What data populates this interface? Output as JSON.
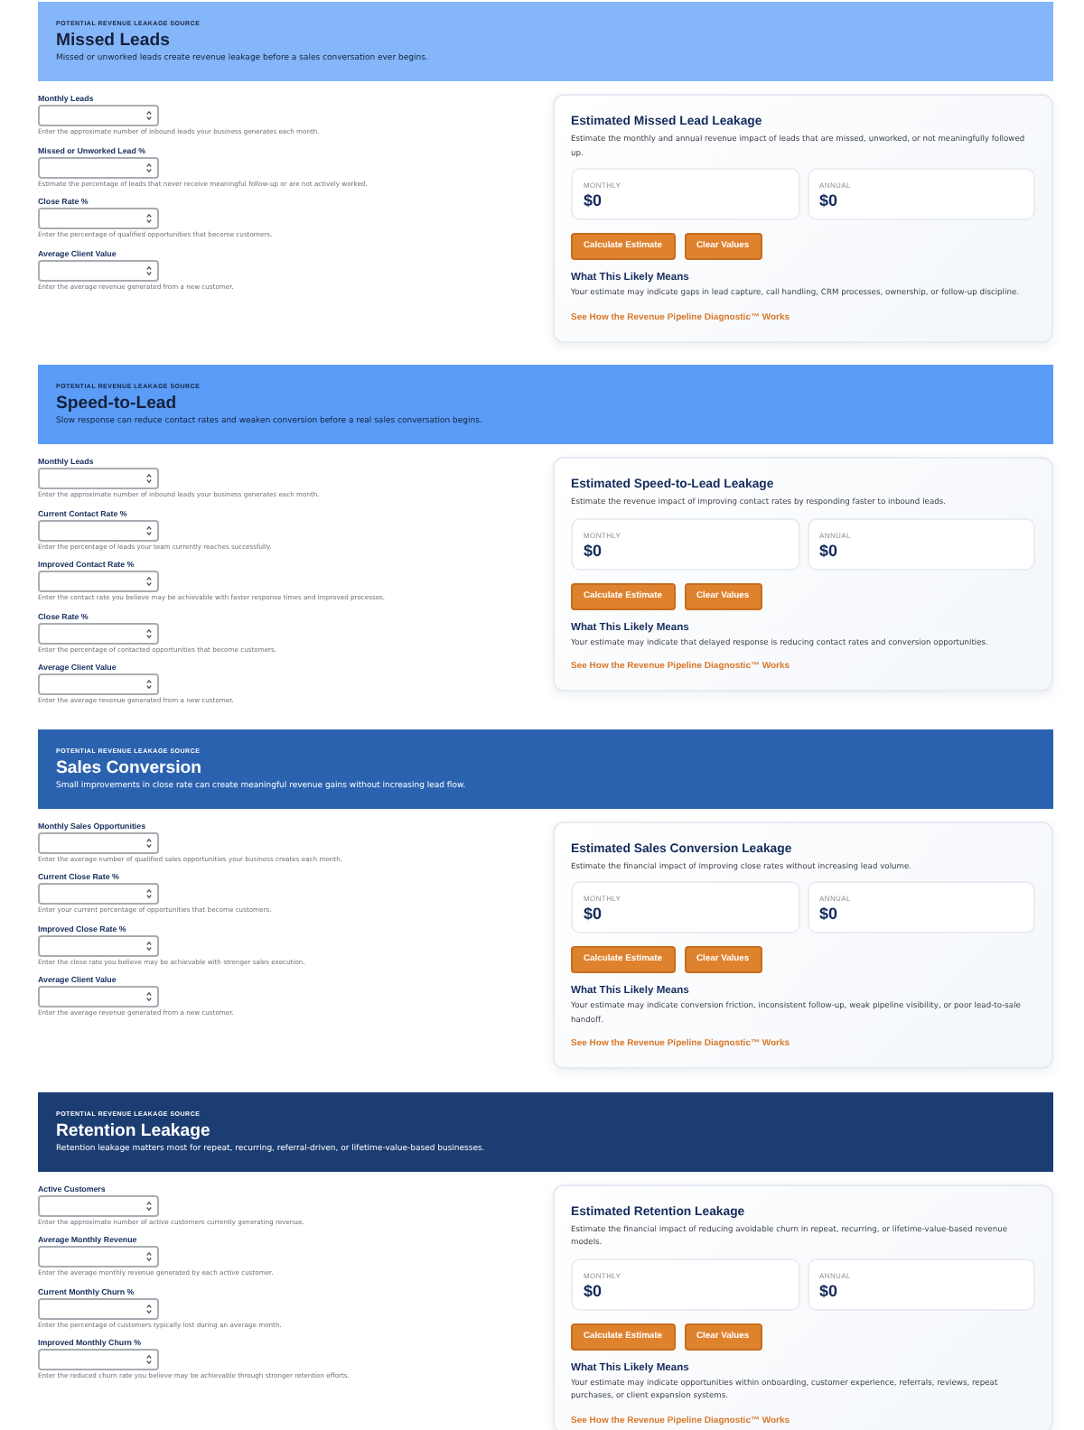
{
  "sections": [
    {
      "eyebrow": "POTENTIAL REVENUE LEAKAGE SOURCE",
      "title": "Missed Leads",
      "subtitle": "Missed or unworked leads create revenue leakage before a sales conversation ever begins.",
      "color": "#85b6f9",
      "fields": [
        {
          "label": "Monthly Leads",
          "help": "Enter the approximate number of inbound leads your business generates each month."
        },
        {
          "label": "Missed or Unworked Lead %",
          "help": "Estimate the percentage of leads that never receive meaningful follow-up or are not actively worked."
        },
        {
          "label": "Close Rate %",
          "help": "Enter the percentage of qualified opportunities that become customers."
        },
        {
          "label": "Average Client Value",
          "help": "Enter the average revenue generated from a new customer."
        }
      ],
      "card": {
        "title": "Estimated Missed Lead Leakage",
        "description": "Estimate the monthly and annual revenue impact of leads that are missed, unworked, or not meaningfully followed up.",
        "results": [
          {
            "label": "MONTHLY",
            "value": "$0"
          },
          {
            "label": "ANNUAL",
            "value": "$0"
          }
        ],
        "buttons": [
          "Calculate Estimate",
          "Clear Values"
        ],
        "means_title": "What This Likely Means",
        "means_text": "Your estimate may indicate gaps in lead capture, call handling, CRM processes, ownership, or follow-up discipline.",
        "link": "See How the Revenue Pipeline Diagnostic™ Works"
      }
    },
    {
      "eyebrow": "POTENTIAL REVENUE LEAKAGE SOURCE",
      "title": "Speed-to-Lead",
      "subtitle": "Slow response can reduce contact rates and weaken conversion before a real sales conversation begins.",
      "color": "#5a9cf8",
      "fields": [
        {
          "label": "Monthly Leads",
          "help": "Enter the approximate number of inbound leads your business generates each month."
        },
        {
          "label": "Current Contact Rate %",
          "help": "Enter the percentage of leads your team currently reaches successfully."
        },
        {
          "label": "Improved Contact Rate %",
          "help": "Enter the contact rate you believe may be achievable with faster response times and improved processes."
        },
        {
          "label": "Close Rate %",
          "help": "Enter the percentage of contacted opportunities that become customers."
        },
        {
          "label": "Average Client Value",
          "help": "Enter the average revenue generated from a new customer."
        }
      ],
      "card": {
        "title": "Estimated Speed-to-Lead Leakage",
        "description": "Estimate the revenue impact of improving contact rates by responding faster to inbound leads.",
        "results": [
          {
            "label": "MONTHLY",
            "value": "$0"
          },
          {
            "label": "ANNUAL",
            "value": "$0"
          }
        ],
        "buttons": [
          "Calculate Estimate",
          "Clear Values"
        ],
        "means_title": "What This Likely Means",
        "means_text": "Your estimate may indicate that delayed response is reducing contact rates and conversion opportunities.",
        "link": "See How the Revenue Pipeline Diagnostic™ Works"
      }
    },
    {
      "eyebrow": "POTENTIAL REVENUE LEAKAGE SOURCE",
      "title": "Sales Conversion",
      "subtitle": "Small improvements in close rate can create meaningful revenue gains without increasing lead flow.",
      "color": "#2b62b0",
      "fields": [
        {
          "label": "Monthly Sales Opportunities",
          "help": "Enter the average number of qualified sales opportunities your business creates each month."
        },
        {
          "label": "Current Close Rate %",
          "help": "Enter your current percentage of opportunities that become customers."
        },
        {
          "label": "Improved Close Rate %",
          "help": "Enter the close rate you believe may be achievable with stronger sales execution."
        },
        {
          "label": "Average Client Value",
          "help": "Enter the average revenue generated from a new customer."
        }
      ],
      "card": {
        "title": "Estimated Sales Conversion Leakage",
        "description": "Estimate the financial impact of improving close rates without increasing lead volume.",
        "results": [
          {
            "label": "MONTHLY",
            "value": "$0"
          },
          {
            "label": "ANNUAL",
            "value": "$0"
          }
        ],
        "buttons": [
          "Calculate Estimate",
          "Clear Values"
        ],
        "means_title": "What This Likely Means",
        "means_text": "Your estimate may indicate conversion friction, inconsistent follow-up, weak pipeline visibility, or poor lead-to-sale handoff.",
        "link": "See How the Revenue Pipeline Diagnostic™ Works"
      }
    },
    {
      "eyebrow": "POTENTIAL REVENUE LEAKAGE SOURCE",
      "title": "Retention Leakage",
      "subtitle": "Retention leakage matters most for repeat, recurring, referral-driven, or lifetime-value-based businesses.",
      "color": "#1b3d72",
      "fields": [
        {
          "label": "Active Customers",
          "help": "Enter the approximate number of active customers currently generating revenue."
        },
        {
          "label": "Average Monthly Revenue",
          "help": "Enter the average monthly revenue generated by each active customer."
        },
        {
          "label": "Current Monthly Churn %",
          "help": "Enter the percentage of customers typically lost during an average month."
        },
        {
          "label": "Improved Monthly Churn %",
          "help": "Enter the reduced churn rate you believe may be achievable through stronger retention efforts."
        }
      ],
      "card": {
        "title": "Estimated Retention Leakage",
        "description": "Estimate the financial impact of reducing avoidable churn in repeat, recurring, or lifetime-value-based revenue models.",
        "results": [
          {
            "label": "MONTHLY",
            "value": "$0"
          },
          {
            "label": "ANNUAL",
            "value": "$0"
          }
        ],
        "buttons": [
          "Calculate Estimate",
          "Clear Values"
        ],
        "means_title": "What This Likely Means",
        "means_text": "Your estimate may indicate opportunities within onboarding, customer experience, referrals, reviews, repeat purchases, or client expansion systems.",
        "link": "See How the Revenue Pipeline Diagnostic™ Works"
      }
    }
  ]
}
